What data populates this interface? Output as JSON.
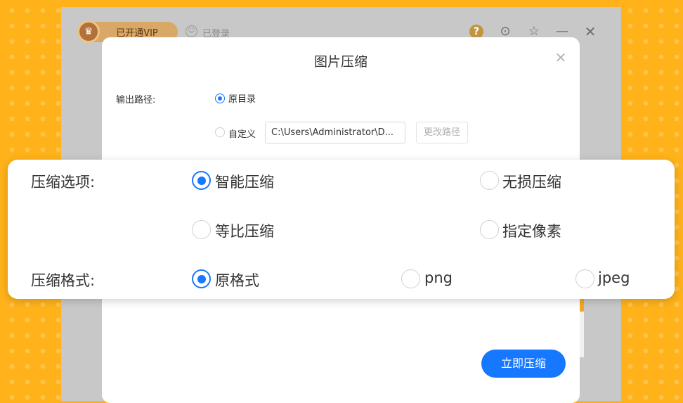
{
  "background_window": {
    "vip_label": "已开通VIP",
    "login_label": "已登录",
    "icons": [
      "crown-icon",
      "user-icon",
      "help-icon",
      "more-icon",
      "star-icon",
      "minimize-icon",
      "close-icon"
    ]
  },
  "dialog": {
    "title": "图片压缩",
    "output_path": {
      "label": "输出路径:",
      "option_original": "原目录",
      "option_custom": "自定义",
      "selected": "原目录",
      "path_value": "C:\\Users\\Administrator\\D...",
      "change_button": "更改路径"
    },
    "compress_button": "立即压缩"
  },
  "zoom": {
    "compress_options_label": "压缩选项:",
    "compress_options": [
      "智能压缩",
      "无损压缩",
      "等比压缩",
      "指定像素"
    ],
    "compress_selected": "智能压缩",
    "format_label": "压缩格式:",
    "formats": [
      "原格式",
      "png",
      "jpeg"
    ],
    "format_selected": "原格式"
  },
  "colors": {
    "accent": "#1677ff",
    "background": "#ffb21a",
    "vip_gold": "#d9a766"
  }
}
